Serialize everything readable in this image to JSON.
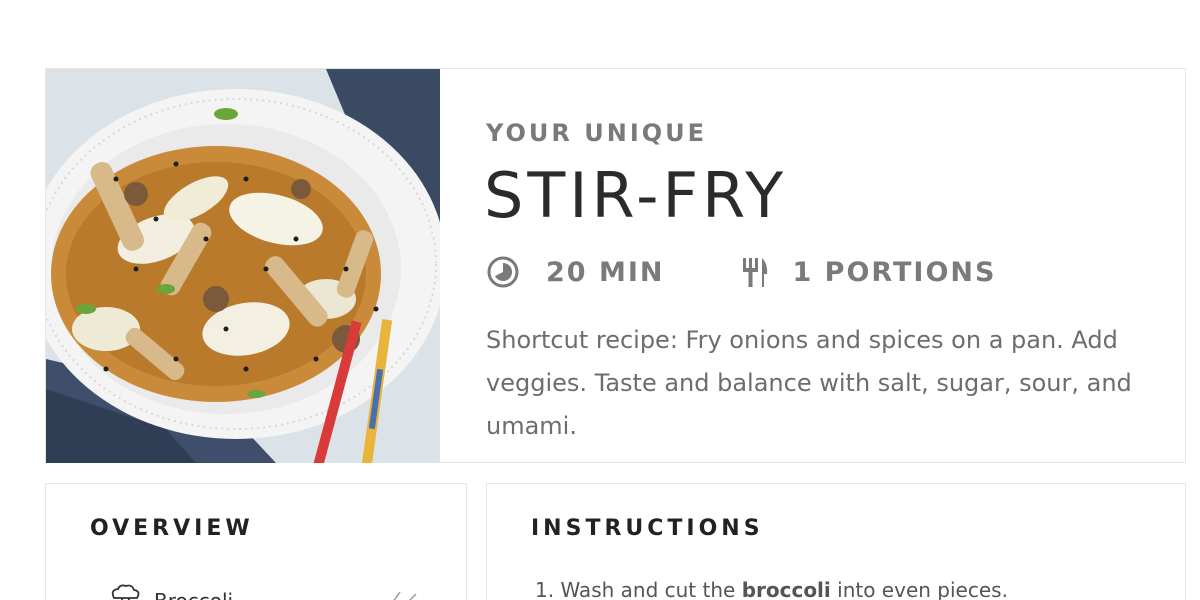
{
  "hero": {
    "eyebrow": "YOUR UNIQUE",
    "title": "STIR-FRY",
    "time_value": "20 MIN",
    "time_icon": "clock-icon",
    "servings_value": "1 PORTIONS",
    "servings_icon": "fork-knife-icon",
    "description": "Shortcut recipe: Fry onions and spices on a pan. Add veggies. Taste and balance with salt, sugar, sour, and umami.",
    "photo": "stir-fry-bowl-photo"
  },
  "overview": {
    "heading": "OVERVIEW",
    "ingredient_icon": "broccoli-icon",
    "ingredient_name": "Broccoli",
    "trailing_icon": "edit-icon"
  },
  "instructions": {
    "heading": "INSTRUCTIONS",
    "step1_prefix": "1. Wash and cut the ",
    "step1_bold": "broccoli",
    "step1_suffix": " into even pieces."
  },
  "colors": {
    "muted_text": "#7a7a7a",
    "title_text": "#2b2b2b",
    "border": "#e6e6e6",
    "chopstick_red": "#d93a3a",
    "chopstick_yellow": "#e8b43a"
  }
}
